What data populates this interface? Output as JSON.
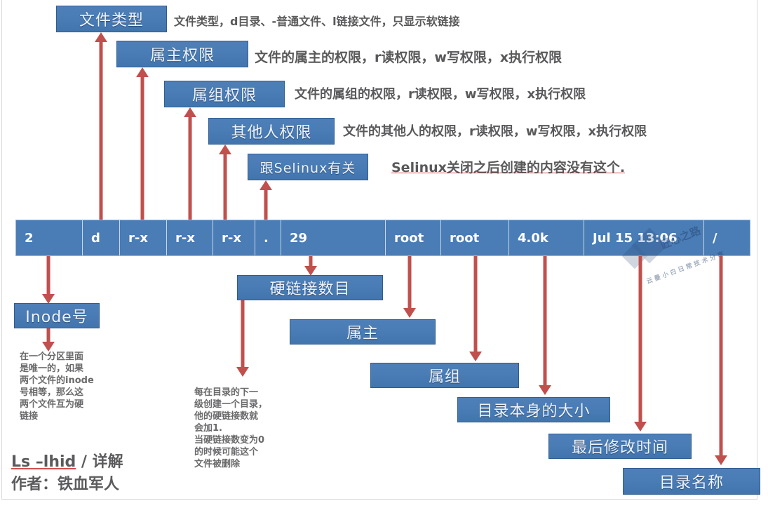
{
  "title": "Ls -lhid / 详解",
  "colors": {
    "box_fill": "#4a7cb5",
    "box_border": "#2f5d90",
    "arrow": "#c0504d",
    "explain_text": "#59595b",
    "row_fill": "#4a7cb5"
  },
  "top_callouts": [
    {
      "label": "文件类型",
      "explain": "文件类型，d目录、-普通文件、l链接文件，只显示软链接"
    },
    {
      "label": "属主权限",
      "explain": "文件的属主的权限，r读权限，w写权限，x执行权限"
    },
    {
      "label": "属组权限",
      "explain": "文件的属组的权限，r读权限，w写权限，x执行权限"
    },
    {
      "label": "其他人权限",
      "explain": "文件的其他人的权限，r读权限，w写权限，x执行权限"
    },
    {
      "label": "跟Selinux有关",
      "explain": "Selinux关闭之后创建的内容没有这个."
    }
  ],
  "ls_row": {
    "cells": [
      {
        "value": "2"
      },
      {
        "value": "d"
      },
      {
        "value": "r-x"
      },
      {
        "value": "r-x"
      },
      {
        "value": "r-x"
      },
      {
        "value": "."
      },
      {
        "value": "29"
      },
      {
        "value": "root"
      },
      {
        "value": "root"
      },
      {
        "value": "4.0k"
      },
      {
        "value": "Jul 15 13:06"
      },
      {
        "value": "/"
      }
    ]
  },
  "bottom_callouts": [
    {
      "label": "Inode号"
    },
    {
      "label": "硬链接数目"
    },
    {
      "label": "属主"
    },
    {
      "label": "属组"
    },
    {
      "label": "目录本身的大小"
    },
    {
      "label": "最后修改时间"
    },
    {
      "label": "目录名称"
    }
  ],
  "paragraphs": {
    "inode": [
      "在一个分区里面",
      "是唯一的，如果",
      "两个文件的inode",
      "号相等，那么这",
      "两个文件互为硬",
      "链接"
    ],
    "hardlink": [
      "每在目录的下一",
      "级创建一个目录，",
      "他的硬链接数就",
      "会加1.",
      "当硬链接数变为0",
      "的时候可能这个",
      "文件被删除"
    ]
  },
  "footer": {
    "line1_cmd": "Ls –lhid",
    "line1_rest": " / 详解",
    "line2": "作者：铁血军人"
  },
  "watermark": {
    "main": "匠心之路",
    "sub": "云曼小白日常技术分享"
  }
}
